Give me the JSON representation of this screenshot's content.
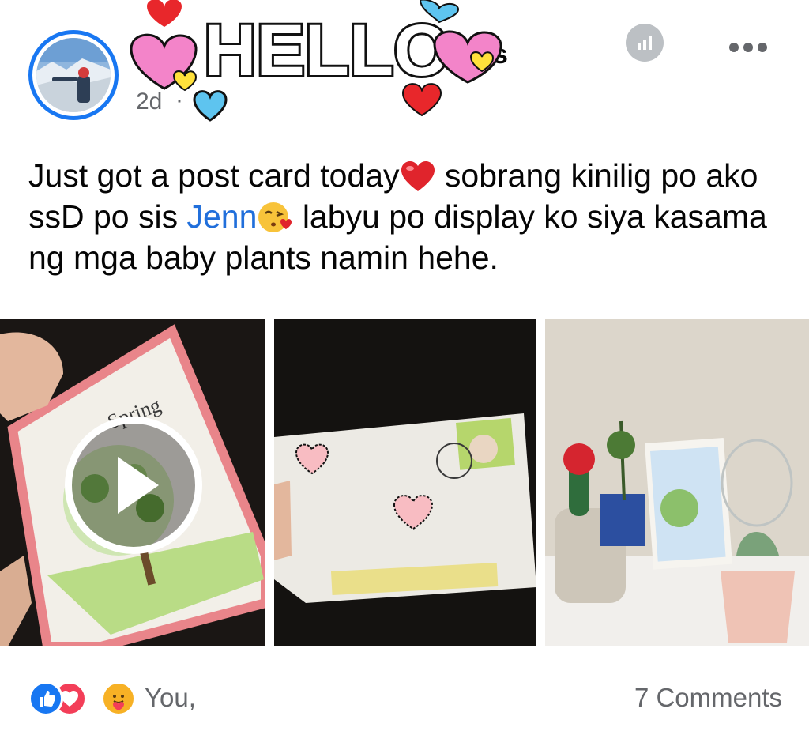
{
  "post": {
    "author_visible_fragment": "s",
    "author_hidden_fragment": "’",
    "timestamp": "2d",
    "separator": "·",
    "sticker_text": "HELLO",
    "text_part1": "Just got a post card today",
    "text_part2": " sobrang kinilig po ako ssD po sis ",
    "mention": "Jenn",
    "text_part3": " labyu po display ko siya kasama ng mga baby plants namin hehe.",
    "emojis": [
      "heart-emoji",
      "face-blowing-kiss-emoji"
    ]
  },
  "header": {
    "insights_icon": "bar-chart-icon",
    "more_icon": "more-dots-icon"
  },
  "photos": [
    {
      "name": "photo-card-video",
      "has_play": true
    },
    {
      "name": "photo-envelope",
      "has_play": false
    },
    {
      "name": "photo-plants-display",
      "has_play": false
    }
  ],
  "footer": {
    "reactions": [
      "like-reaction",
      "love-reaction",
      "care-reaction"
    ],
    "reactors": "You,",
    "comments": "7 Comments"
  },
  "colors": {
    "accent": "#1877f2",
    "mention": "#216fdb",
    "secondary_text": "#65676b",
    "like": "#1877f2",
    "love": "#f33e58",
    "care": "#f7b125"
  }
}
